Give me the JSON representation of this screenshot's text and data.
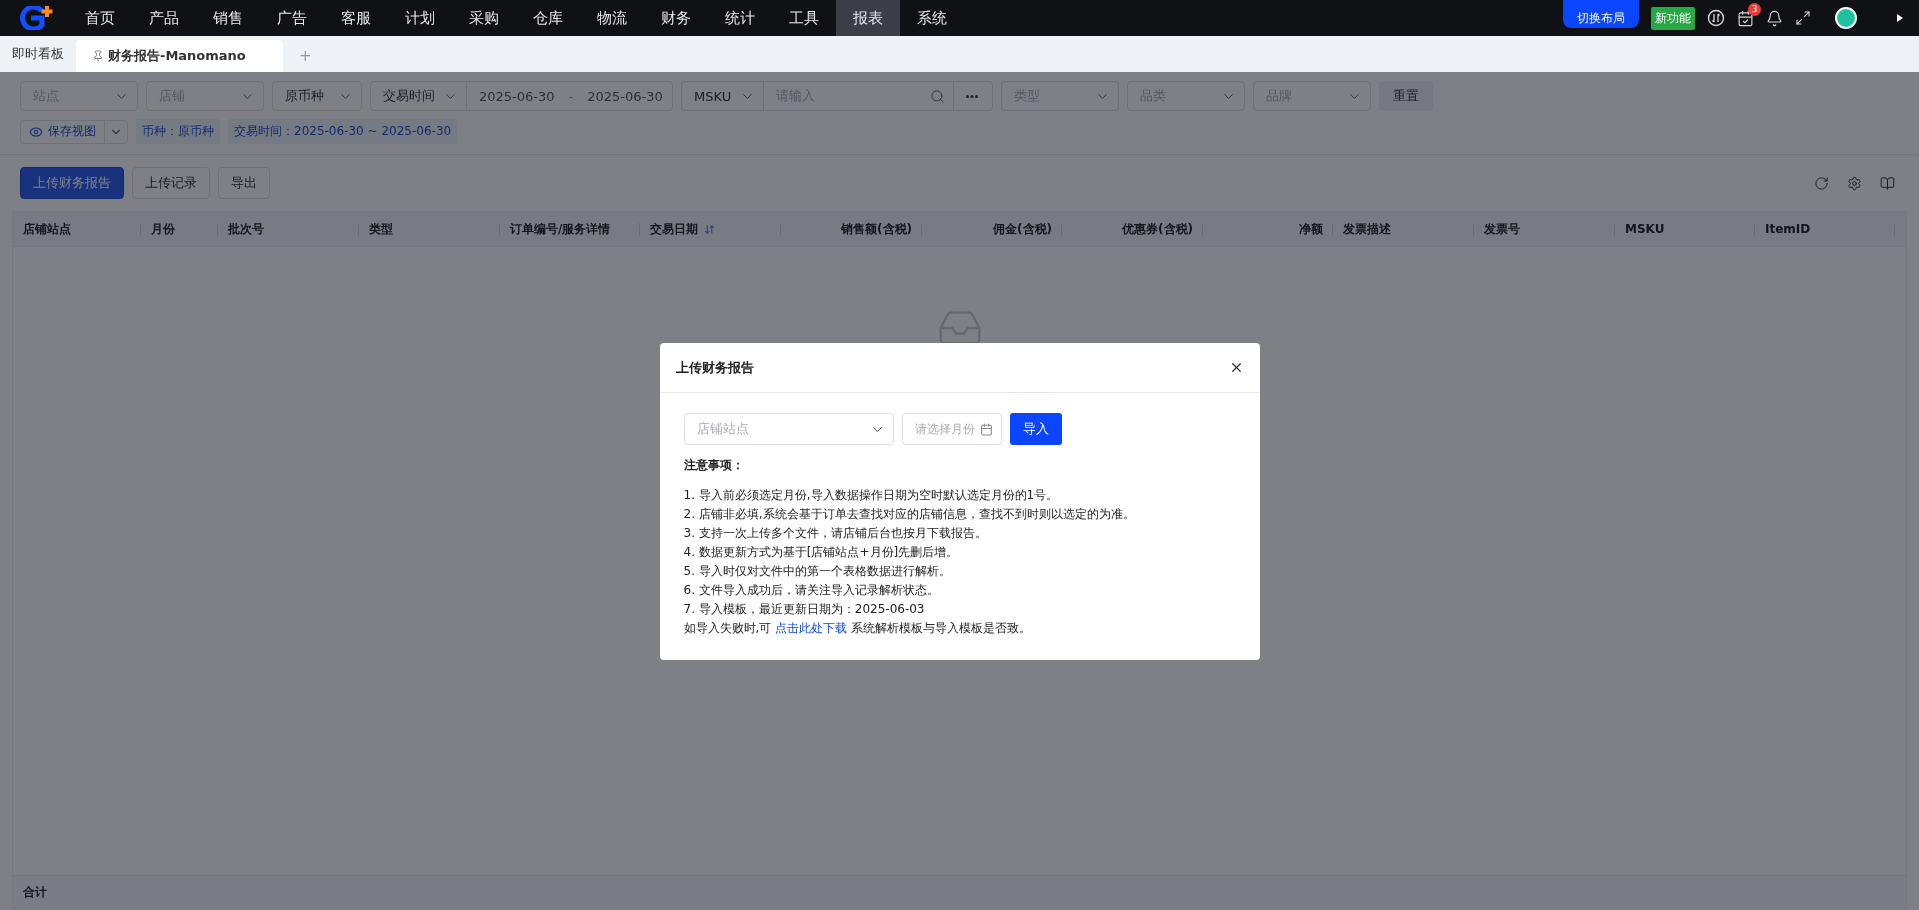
{
  "nav": {
    "items": [
      {
        "label": "首页",
        "selected": false
      },
      {
        "label": "产品",
        "selected": false
      },
      {
        "label": "销售",
        "selected": false
      },
      {
        "label": "广告",
        "selected": false
      },
      {
        "label": "客服",
        "selected": false
      },
      {
        "label": "计划",
        "selected": false
      },
      {
        "label": "采购",
        "selected": false
      },
      {
        "label": "仓库",
        "selected": false
      },
      {
        "label": "物流",
        "selected": false
      },
      {
        "label": "财务",
        "selected": false
      },
      {
        "label": "统计",
        "selected": false
      },
      {
        "label": "工具",
        "selected": false
      },
      {
        "label": "报表",
        "selected": true
      },
      {
        "label": "系统",
        "selected": false
      }
    ],
    "switch_layout_button": "切换布局",
    "new_feature_badge": "新功能",
    "task_count": "3"
  },
  "tabs": [
    {
      "label": "即时看板",
      "selected": false,
      "pinned": false
    },
    {
      "label": "财务报告-Manomano",
      "selected": true,
      "pinned": true
    }
  ],
  "add_tab": "+",
  "filters": [
    {
      "kind": "select",
      "placeholder": "站点"
    },
    {
      "kind": "select",
      "placeholder": "店铺"
    },
    {
      "kind": "select",
      "value": "原币种"
    },
    {
      "kind": "date_range",
      "field": "交易时间",
      "start": "2025-06-30",
      "separator": "-",
      "end": "2025-06-30"
    },
    {
      "kind": "search",
      "field": "MSKU",
      "placeholder": "请输入"
    },
    {
      "kind": "select",
      "placeholder": "类型"
    },
    {
      "kind": "select",
      "placeholder": "品类"
    },
    {
      "kind": "select",
      "placeholder": "品牌"
    }
  ],
  "reset_button": "重置",
  "view": {
    "save_view": "保存视图",
    "conditions": [
      "币种：原币种",
      "交易时间：2025-06-30 ~ 2025-06-30"
    ]
  },
  "toolbar": {
    "buttons": [
      {
        "label": "上传财务报告",
        "primary": true
      },
      {
        "label": "上传记录",
        "primary": false
      },
      {
        "label": "导出",
        "primary": false
      }
    ]
  },
  "table": {
    "columns": [
      {
        "label": "店铺站点",
        "kind": "text",
        "sorted": false
      },
      {
        "label": "月份",
        "kind": "text",
        "sorted": false
      },
      {
        "label": "批次号",
        "kind": "text",
        "sorted": false
      },
      {
        "label": "类型",
        "kind": "text",
        "sorted": false
      },
      {
        "label": "订单编号/服务详情",
        "kind": "text",
        "sorted": false
      },
      {
        "label": "交易日期",
        "kind": "text",
        "sorted": true
      },
      {
        "label": "销售额(含税)",
        "kind": "amount",
        "sorted": false
      },
      {
        "label": "佣金(含税)",
        "kind": "amount",
        "sorted": false
      },
      {
        "label": "优惠券(含税)",
        "kind": "amount",
        "sorted": false
      },
      {
        "label": "净额",
        "kind": "amount",
        "sorted": false
      },
      {
        "label": "发票描述",
        "kind": "text",
        "sorted": false
      },
      {
        "label": "发票号",
        "kind": "text",
        "sorted": false
      },
      {
        "label": "MSKU",
        "kind": "text",
        "sorted": false
      },
      {
        "label": "ItemID",
        "kind": "text",
        "sorted": false
      }
    ],
    "footer": "合计"
  },
  "dialog": {
    "title": "上传财务报告",
    "store_select": {
      "placeholder": "店铺站点"
    },
    "month_field": {
      "placeholder": "请选择月份"
    },
    "import_button": "导入",
    "notes_title": "注意事项：",
    "notes": [
      "1. 导入前必须选定月份,导入数据操作日期为空时默认选定月份的1号。",
      "2. 店铺非必填,系统会基于订单去查找对应的店铺信息，查找不到时则以选定的为准。",
      "3. 支持一次上传多个文件，请店铺后台也按月下载报告。",
      "4. 数据更新方式为基于[店铺站点+月份]先删后增。",
      "5. 导入时仅对文件中的第一个表格数据进行解析。",
      "6. 文件导入成功后，请关注导入记录解析状态。",
      "7. 导入模板，最近更新日期为：2025-06-03"
    ],
    "footer_before": "如导入失败时,可",
    "link": "点击此处下载",
    "footer_after": "系统解析模板与导入模板是否致。"
  }
}
